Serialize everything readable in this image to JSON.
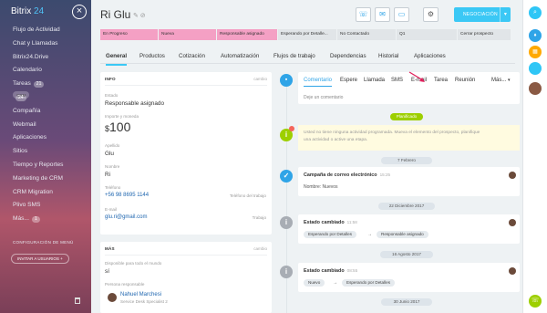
{
  "app": {
    "brand": "Bitrix",
    "brand_num": "24"
  },
  "sidebar": {
    "items": [
      {
        "label": "Flujo de Actividad"
      },
      {
        "label": "Chat y Llamadas"
      },
      {
        "label": "Bitrix24.Drive"
      },
      {
        "label": "Calendario"
      },
      {
        "label": "Tareas",
        "badge": "21"
      },
      {
        "label": "CRM",
        "badge": "24",
        "active": true
      },
      {
        "label": "Compañía"
      },
      {
        "label": "Webmail"
      },
      {
        "label": "Aplicaciones"
      },
      {
        "label": "Sitios"
      },
      {
        "label": "Tiempo y Reportes"
      },
      {
        "label": "Marketing de CRM"
      },
      {
        "label": "CRM Migration"
      },
      {
        "label": "Plivo SMS"
      },
      {
        "label": "Más...",
        "badge": "1"
      }
    ],
    "config_label": "CONFIGURACIÓN DE MENÚ",
    "invite_label": "INVITAR A USUARIOS  +"
  },
  "header": {
    "title": "Ri Glu",
    "deal_button": "NEGOCIACIÓN",
    "icons": [
      "phone-icon",
      "email-icon",
      "chat-icon",
      "settings-icon"
    ]
  },
  "stages": [
    {
      "label": "En Progreso",
      "color": "#f4a0c4"
    },
    {
      "label": "Nueva",
      "color": "#f4a0c4"
    },
    {
      "label": "Responsable asignado",
      "color": "#f4a0c4"
    },
    {
      "label": "Esperando por Detalle...",
      "color": "#e1e5e8"
    },
    {
      "label": "No Contactado",
      "color": "#e1e5e8"
    },
    {
      "label": "Q1",
      "color": "#e1e5e8"
    },
    {
      "label": "Cerrar prospecto",
      "color": "#e1e5e8"
    }
  ],
  "tabs": [
    "General",
    "Productos",
    "Cotización",
    "Automatización",
    "Flujos de trabajo",
    "Dependencias",
    "Historial",
    "Aplicaciones"
  ],
  "info_card": {
    "header": "INFO",
    "change": "cambio",
    "estado_label": "Estado",
    "estado_value": "Responsable asignado",
    "importe_label": "Importe y moneda",
    "currency": "$",
    "amount": "100",
    "apellido_label": "Apellido",
    "apellido_value": "Glu",
    "nombre_label": "Nombre",
    "nombre_value": "Ri",
    "telefono_label": "Teléfono",
    "telefono_value": "+56 98 8695 1144",
    "telefono_side": "Teléfono del trabajo",
    "email_label": "E-mail",
    "email_value": "glu.ri@gmail.com",
    "email_side": "Trabajo"
  },
  "more_card": {
    "header": "MÁS",
    "change": "cambio",
    "available_label": "Disponible para todo el mundo",
    "available_value": "sí",
    "responsible_label": "Persona responsable",
    "responsible_name": "Nahuel Marchesi",
    "responsible_role": "Service Desk Specialist 2"
  },
  "editor": {
    "tabs": [
      "Comentario",
      "Espere",
      "Llamada",
      "SMS",
      "E-mail",
      "Tarea",
      "Reunión",
      "Más..."
    ],
    "placeholder": "Deje un comentario"
  },
  "timeline": {
    "planned_label": "Planificado",
    "planned_text_1": "Usted no tiene ninguna actividad programada. Mueva el elemento del prospecto, planifique",
    "planned_text_2": "una actividad o active una etapa.",
    "date1": "7 Febrero",
    "campaign_title": "Campaña de correo electrónico",
    "campaign_time": "15:25",
    "campaign_text": "Nombre: Nuevos",
    "date2": "22 Diciembre 2017",
    "state1_title": "Estado cambiado",
    "state1_time": "11:58",
    "state1_from": "Esperando por Detalles",
    "state1_to": "Responsable asignado",
    "date3": "16 Agosto 2017",
    "state2_title": "Estado cambiado",
    "state2_time": "08:55",
    "state2_from": "Nuevo",
    "state2_to": "Esperando por Detalles",
    "date4": "30 Junio 2017",
    "arrow": "→"
  }
}
